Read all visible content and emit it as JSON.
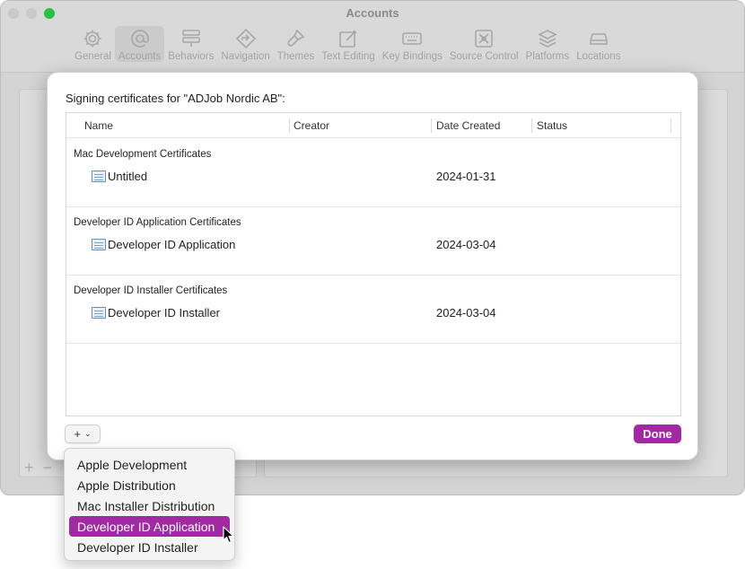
{
  "window": {
    "title": "Accounts",
    "traffic_colors": [
      "#c9c9c9",
      "#c9c9c9",
      "#29c13f"
    ]
  },
  "toolbar": {
    "items": [
      {
        "label": "General",
        "icon": "gear-icon"
      },
      {
        "label": "Accounts",
        "icon": "at-icon",
        "active": true
      },
      {
        "label": "Behaviors",
        "icon": "behaviors-icon"
      },
      {
        "label": "Navigation",
        "icon": "navigation-icon"
      },
      {
        "label": "Themes",
        "icon": "brush-icon"
      },
      {
        "label": "Text Editing",
        "icon": "pencil-square-icon"
      },
      {
        "label": "Key Bindings",
        "icon": "keyboard-icon"
      },
      {
        "label": "Source Control",
        "icon": "source-control-icon"
      },
      {
        "label": "Platforms",
        "icon": "layers-icon"
      },
      {
        "label": "Locations",
        "icon": "drive-icon"
      }
    ]
  },
  "sheet": {
    "title": "Signing certificates for \"ADJob Nordic AB\":",
    "columns": {
      "name": "Name",
      "creator": "Creator",
      "date_created": "Date Created",
      "status": "Status"
    },
    "groups": [
      {
        "label": "Mac Development Certificates",
        "name": "Untitled",
        "date": "2024-01-31"
      },
      {
        "label": "Developer ID Application Certificates",
        "name": "Developer ID Application",
        "date": "2024-03-04"
      },
      {
        "label": "Developer ID Installer Certificates",
        "name": "Developer ID Installer",
        "date": "2024-03-04"
      }
    ],
    "add_label": "+",
    "done_label": "Done"
  },
  "menu": {
    "items": [
      {
        "label": "Apple Development"
      },
      {
        "label": "Apple Distribution"
      },
      {
        "label": "Mac Installer Distribution"
      },
      {
        "label": "Developer ID Application",
        "selected": true
      },
      {
        "label": "Developer ID Installer"
      }
    ]
  },
  "colors": {
    "accent": "#a12aa3"
  }
}
